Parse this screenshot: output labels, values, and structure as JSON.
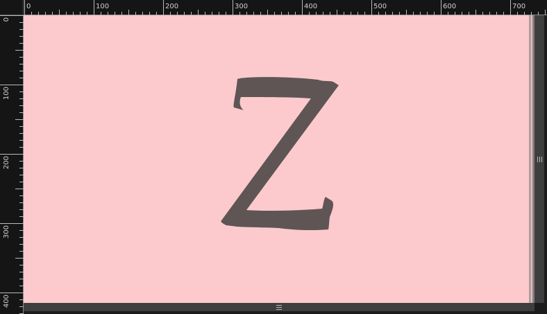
{
  "app": {
    "canvas_color": "#fccacc",
    "glyph_color": "#5f5555"
  },
  "glyph": {
    "character": "Z"
  },
  "ruler_top": {
    "unit_labels": [
      "0",
      "100",
      "200",
      "300",
      "400",
      "500",
      "600",
      "700"
    ]
  },
  "ruler_left": {
    "unit_labels": [
      "0",
      "100",
      "200",
      "300",
      "400"
    ]
  },
  "scrollbars": {
    "vertical_icon": "grip-lines-icon",
    "horizontal_icon": "grip-lines-icon"
  }
}
